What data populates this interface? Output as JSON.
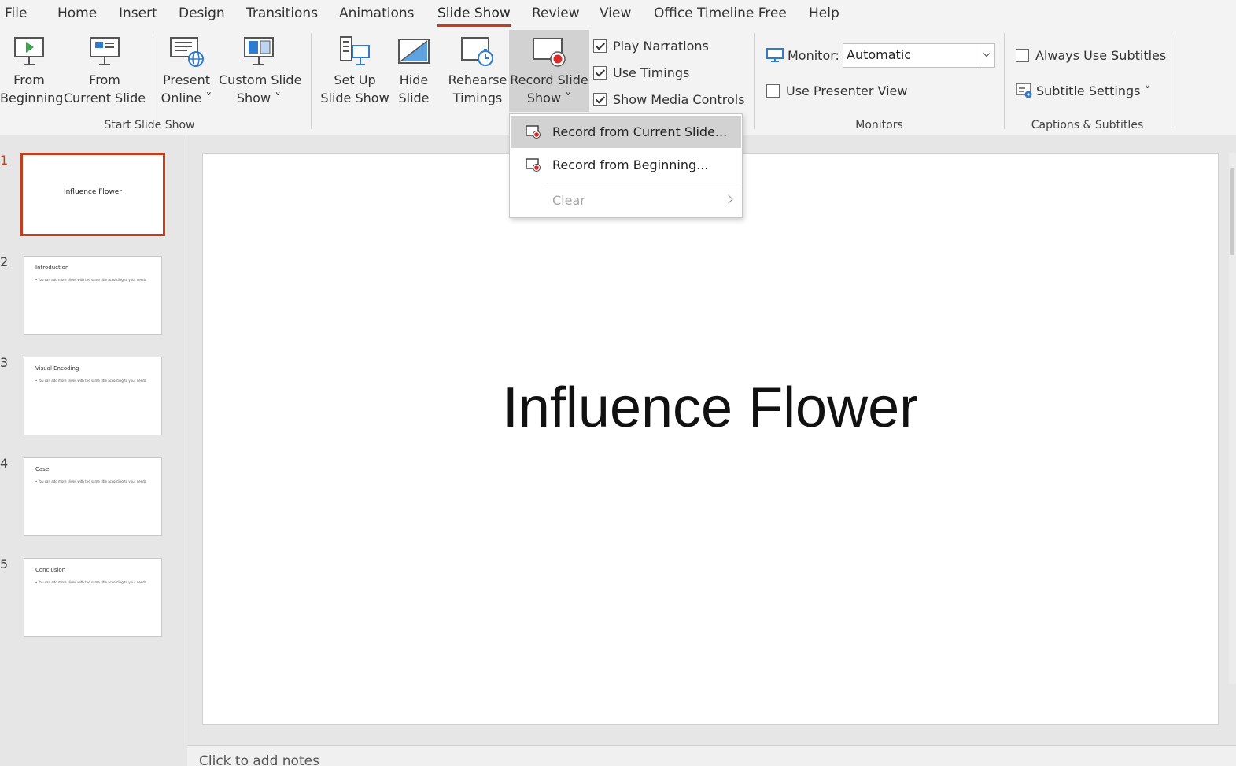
{
  "tabs": [
    "File",
    "Home",
    "Insert",
    "Design",
    "Transitions",
    "Animations",
    "Slide Show",
    "Review",
    "View",
    "Office Timeline Free",
    "Help"
  ],
  "active_tab": "Slide Show",
  "ribbon": {
    "from_beginning": [
      "From",
      "Beginning"
    ],
    "from_current": [
      "From",
      "Current Slide"
    ],
    "present_online": [
      "Present",
      "Online ˅"
    ],
    "custom_slide_show": [
      "Custom Slide",
      "Show ˅"
    ],
    "group_start": "Start Slide Show",
    "set_up": [
      "Set Up",
      "Slide Show"
    ],
    "hide_slide": [
      "Hide",
      "Slide"
    ],
    "rehearse": [
      "Rehearse",
      "Timings"
    ],
    "record": [
      "Record Slide",
      "Show ˅"
    ],
    "play_narrations": "Play Narrations",
    "use_timings": "Use Timings",
    "show_media_controls": "Show Media Controls",
    "monitor_label": "Monitor:",
    "monitor_value": "Automatic",
    "use_presenter_view": "Use Presenter View",
    "group_monitors": "Monitors",
    "always_subtitles": "Always Use Subtitles",
    "subtitle_settings": "Subtitle Settings ˅",
    "group_captions": "Captions & Subtitles"
  },
  "checkboxes": {
    "play_narrations": true,
    "use_timings": true,
    "show_media_controls": true,
    "use_presenter_view": false,
    "always_subtitles": false
  },
  "menu": {
    "items": [
      "Record from Current Slide...",
      "Record from Beginning...",
      "Clear"
    ]
  },
  "slides": [
    {
      "num": "1",
      "title": "Influence Flower",
      "body": ""
    },
    {
      "num": "2",
      "title": "Introduction",
      "body": "• You can add more slides with the same title according to your needs"
    },
    {
      "num": "3",
      "title": "Visual Encoding",
      "body": "• You can add more slides with the same title according to your needs"
    },
    {
      "num": "4",
      "title": "Case",
      "body": "• You can add more slides with the same title according to your needs"
    },
    {
      "num": "5",
      "title": "Conclusion",
      "body": "• You can add more slides with the same title according to your needs"
    }
  ],
  "current_slide_title": "Influence Flower",
  "notes_placeholder": "Click to add notes",
  "colors": {
    "accent": "#c43e1c",
    "icon_blue": "#2e7bcf",
    "record_red": "#d62b2b"
  }
}
